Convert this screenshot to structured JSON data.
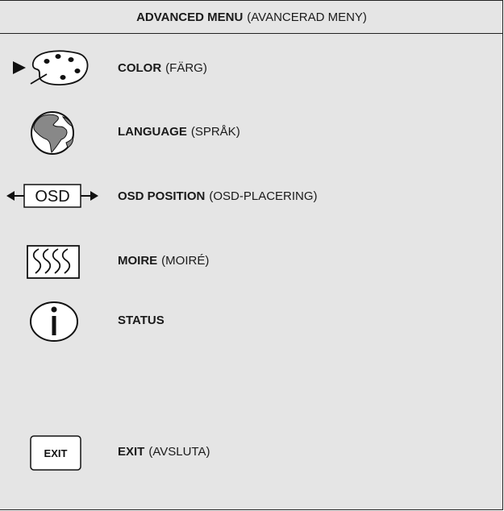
{
  "header": {
    "title_bold": "ADVANCED MENU",
    "title_sub": "(AVANCERAD MENY)"
  },
  "items": [
    {
      "label": "COLOR",
      "sub": "(FÄRG)",
      "icon": "palette-icon",
      "selected": true
    },
    {
      "label": "LANGUAGE",
      "sub": "(SPRÅK)",
      "icon": "globe-icon"
    },
    {
      "label": "OSD POSITION",
      "sub": "(OSD-PLACERING)",
      "icon": "osd-position-icon",
      "icon_text": "OSD"
    },
    {
      "label": "MOIRE",
      "sub": "(MOIRÉ)",
      "icon": "moire-icon"
    },
    {
      "label": "STATUS",
      "sub": "",
      "icon": "info-icon"
    },
    {
      "label": "EXIT",
      "sub": "(AVSLUTA)",
      "icon": "exit-icon",
      "icon_text": "EXIT"
    }
  ],
  "colors": {
    "panel": "#e5e5e5",
    "line": "#222222"
  }
}
